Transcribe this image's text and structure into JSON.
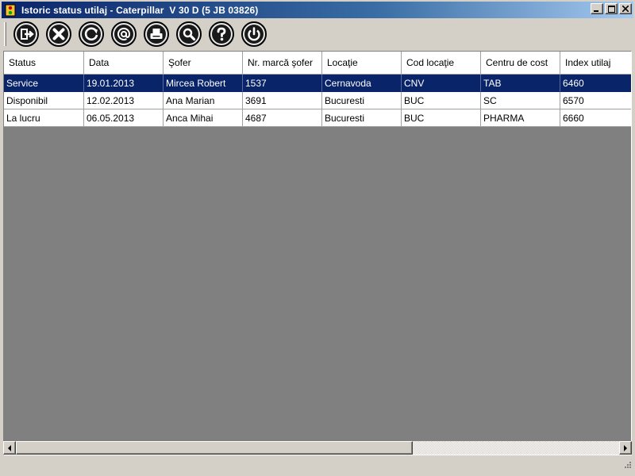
{
  "window": {
    "title": "Istoric status utilaj - Caterpillar  V 30 D (5 JB 03826)",
    "controls": [
      "minimize",
      "maximize",
      "close"
    ]
  },
  "toolbar": {
    "buttons": [
      {
        "name": "exit-button",
        "icon": "exit-icon"
      },
      {
        "name": "delete-button",
        "icon": "x-circle-icon"
      },
      {
        "name": "refresh-button",
        "icon": "refresh-icon"
      },
      {
        "name": "email-button",
        "icon": "at-sign-icon"
      },
      {
        "name": "print-button",
        "icon": "printer-icon"
      },
      {
        "name": "search-button",
        "icon": "magnifier-icon"
      },
      {
        "name": "help-button",
        "icon": "question-icon"
      },
      {
        "name": "power-button",
        "icon": "power-icon"
      }
    ]
  },
  "table": {
    "columns": [
      "Status",
      "Data",
      "Şofer",
      "Nr. marcă şofer",
      "Locaţie",
      "Cod locaţie",
      "Centru de cost",
      "Index utilaj"
    ],
    "selected_row": 0,
    "rows": [
      [
        "Service",
        "19.01.2013",
        "Mircea Robert",
        "1537",
        "Cernavoda",
        "CNV",
        "TAB",
        "6460"
      ],
      [
        "Disponibil",
        "12.02.2013",
        "Ana Marian",
        "3691",
        "Bucuresti",
        "BUC",
        "SC",
        "6570"
      ],
      [
        "La lucru",
        "06.05.2013",
        "Anca Mihai",
        "4687",
        "Bucuresti",
        "BUC",
        "PHARMA",
        "6660"
      ]
    ]
  },
  "colors": {
    "title_bar": "#0a246a",
    "selection": "#0a246a",
    "empty_area": "#808080",
    "window_face": "#d4d0c8"
  }
}
